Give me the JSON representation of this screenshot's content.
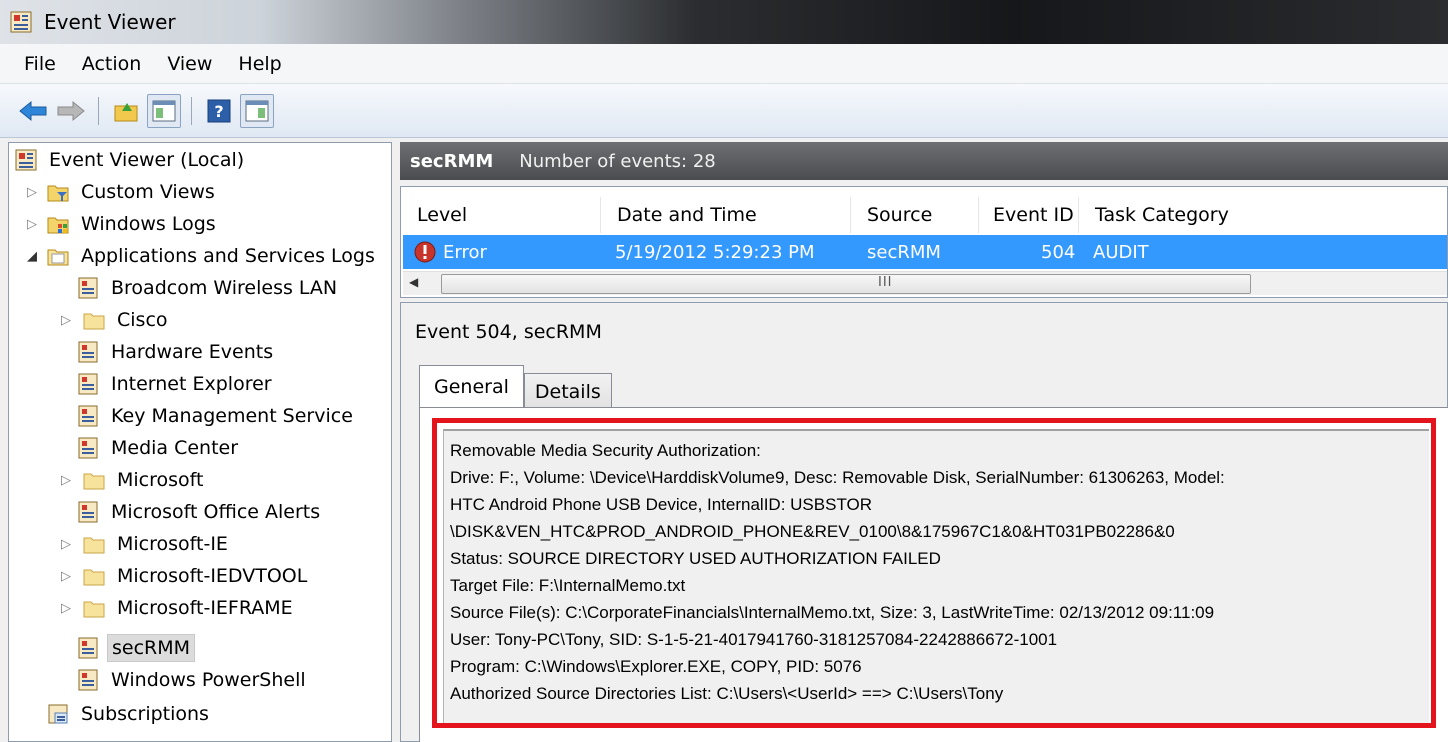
{
  "window": {
    "title": "Event Viewer"
  },
  "menu": [
    "File",
    "Action",
    "View",
    "Help"
  ],
  "toolbar": {
    "buttons": [
      "back-arrow-icon",
      "forward-arrow-icon",
      "up-folder-icon",
      "show-hide-console-tree-icon",
      "help-icon",
      "show-hide-action-pane-icon"
    ]
  },
  "tree": {
    "root": "Event Viewer (Local)",
    "items": [
      {
        "label": "Custom Views",
        "expander": "▷"
      },
      {
        "label": "Windows Logs",
        "expander": "▷"
      },
      {
        "label": "Applications and Services Logs",
        "expander": "◢"
      },
      {
        "label": "Broadcom Wireless LAN",
        "expander": ""
      },
      {
        "label": "Cisco",
        "expander": "▷"
      },
      {
        "label": "Hardware Events",
        "expander": ""
      },
      {
        "label": "Internet Explorer",
        "expander": ""
      },
      {
        "label": "Key Management Service",
        "expander": ""
      },
      {
        "label": "Media Center",
        "expander": ""
      },
      {
        "label": "Microsoft",
        "expander": "▷"
      },
      {
        "label": "Microsoft Office Alerts",
        "expander": ""
      },
      {
        "label": "Microsoft-IE",
        "expander": "▷"
      },
      {
        "label": "Microsoft-IEDVTOOL",
        "expander": "▷"
      },
      {
        "label": "Microsoft-IEFRAME",
        "expander": "▷"
      },
      {
        "label": "secRMM",
        "expander": ""
      },
      {
        "label": "Windows PowerShell",
        "expander": ""
      },
      {
        "label": "Subscriptions",
        "expander": ""
      }
    ]
  },
  "log_header": {
    "name": "secRMM",
    "count": "Number of events: 28"
  },
  "grid": {
    "columns": [
      "Level",
      "Date and Time",
      "Source",
      "Event ID",
      "Task Category"
    ],
    "rows": [
      {
        "level": "Error",
        "datetime": "5/19/2012 5:29:23 PM",
        "source": "secRMM",
        "event_id": "504",
        "task_category": "AUDIT"
      }
    ],
    "scroll_grip": "III"
  },
  "detail": {
    "title": "Event 504, secRMM",
    "tabs": [
      "General",
      "Details"
    ],
    "description": [
      "Removable Media Security Authorization:",
      "Drive: F:, Volume: \\Device\\HarddiskVolume9, Desc: Removable Disk, SerialNumber: 61306263, Model:",
      "HTC Android Phone USB Device, InternalID: USBSTOR",
      "\\DISK&VEN_HTC&PROD_ANDROID_PHONE&REV_0100\\8&175967C1&0&HT031PB02286&0",
      "Status: SOURCE DIRECTORY USED AUTHORIZATION FAILED",
      "Target File: F:\\InternalMemo.txt",
      "Source File(s): C:\\CorporateFinancials\\InternalMemo.txt, Size: 3, LastWriteTime: 02/13/2012 09:11:09",
      "User: Tony-PC\\Tony, SID: S-1-5-21-4017941760-3181257084-2242886672-1001",
      "Program: C:\\Windows\\Explorer.EXE, COPY, PID: 5076",
      "Authorized Source Directories List: C:\\Users\\<UserId> ==> C:\\Users\\Tony"
    ]
  },
  "colors": {
    "selection": "#3399ff",
    "highlight_box": "#e3141b",
    "header_band": "#5b5d60"
  }
}
